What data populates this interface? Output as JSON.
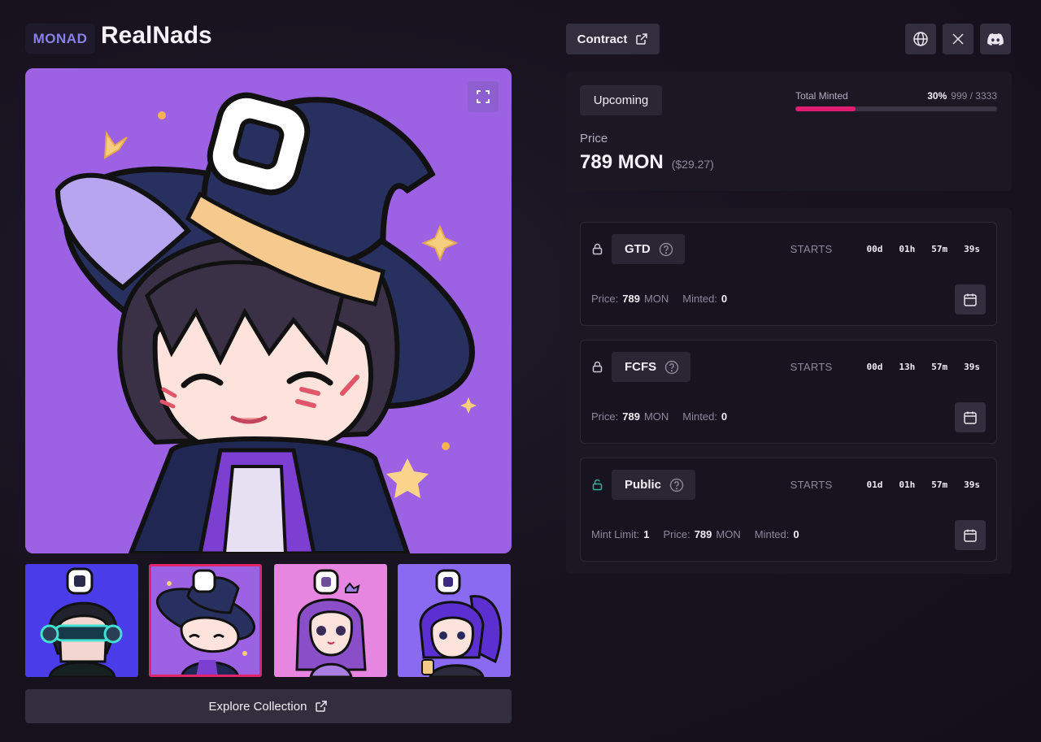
{
  "header": {
    "chain_tag": "MONAD",
    "collection_name": "RealNads",
    "contract_label": "Contract",
    "social_icons": [
      "globe-icon",
      "x-icon",
      "discord-icon"
    ]
  },
  "gallery": {
    "main_image_alt": "Chibi character with witch hat on purple background",
    "thumbnails": [
      "headphones-character",
      "witch-hat-character",
      "purple-hair-character",
      "ponytail-character"
    ],
    "selected_thumbnail": 1,
    "explore_label": "Explore Collection"
  },
  "status": {
    "badge": "Upcoming",
    "minted_label": "Total Minted",
    "minted_percent_text": "30%",
    "minted_count": "999 / 3333",
    "minted_fraction": 0.3,
    "price_label": "Price",
    "price": "789 MON",
    "price_usd": "($29.27)"
  },
  "phases": [
    {
      "name": "GTD",
      "locked": true,
      "starts_label": "STARTS",
      "countdown": [
        "00d",
        "01h",
        "57m",
        "39s"
      ],
      "price_label": "Price:",
      "price_value": "789",
      "price_unit": "MON",
      "minted_label": "Minted:",
      "minted_value": "0"
    },
    {
      "name": "FCFS",
      "locked": true,
      "starts_label": "STARTS",
      "countdown": [
        "00d",
        "13h",
        "57m",
        "39s"
      ],
      "price_label": "Price:",
      "price_value": "789",
      "price_unit": "MON",
      "minted_label": "Minted:",
      "minted_value": "0"
    },
    {
      "name": "Public",
      "locked": false,
      "starts_label": "STARTS",
      "countdown": [
        "01d",
        "01h",
        "57m",
        "39s"
      ],
      "limit_label": "Mint Limit:",
      "limit_value": "1",
      "price_label": "Price:",
      "price_value": "789",
      "price_unit": "MON",
      "minted_label": "Minted:",
      "minted_value": "0"
    }
  ],
  "colors": {
    "accent": "#e01d70",
    "brand": "#8a80e8",
    "unlocked_lock": "#2fb3a0"
  }
}
